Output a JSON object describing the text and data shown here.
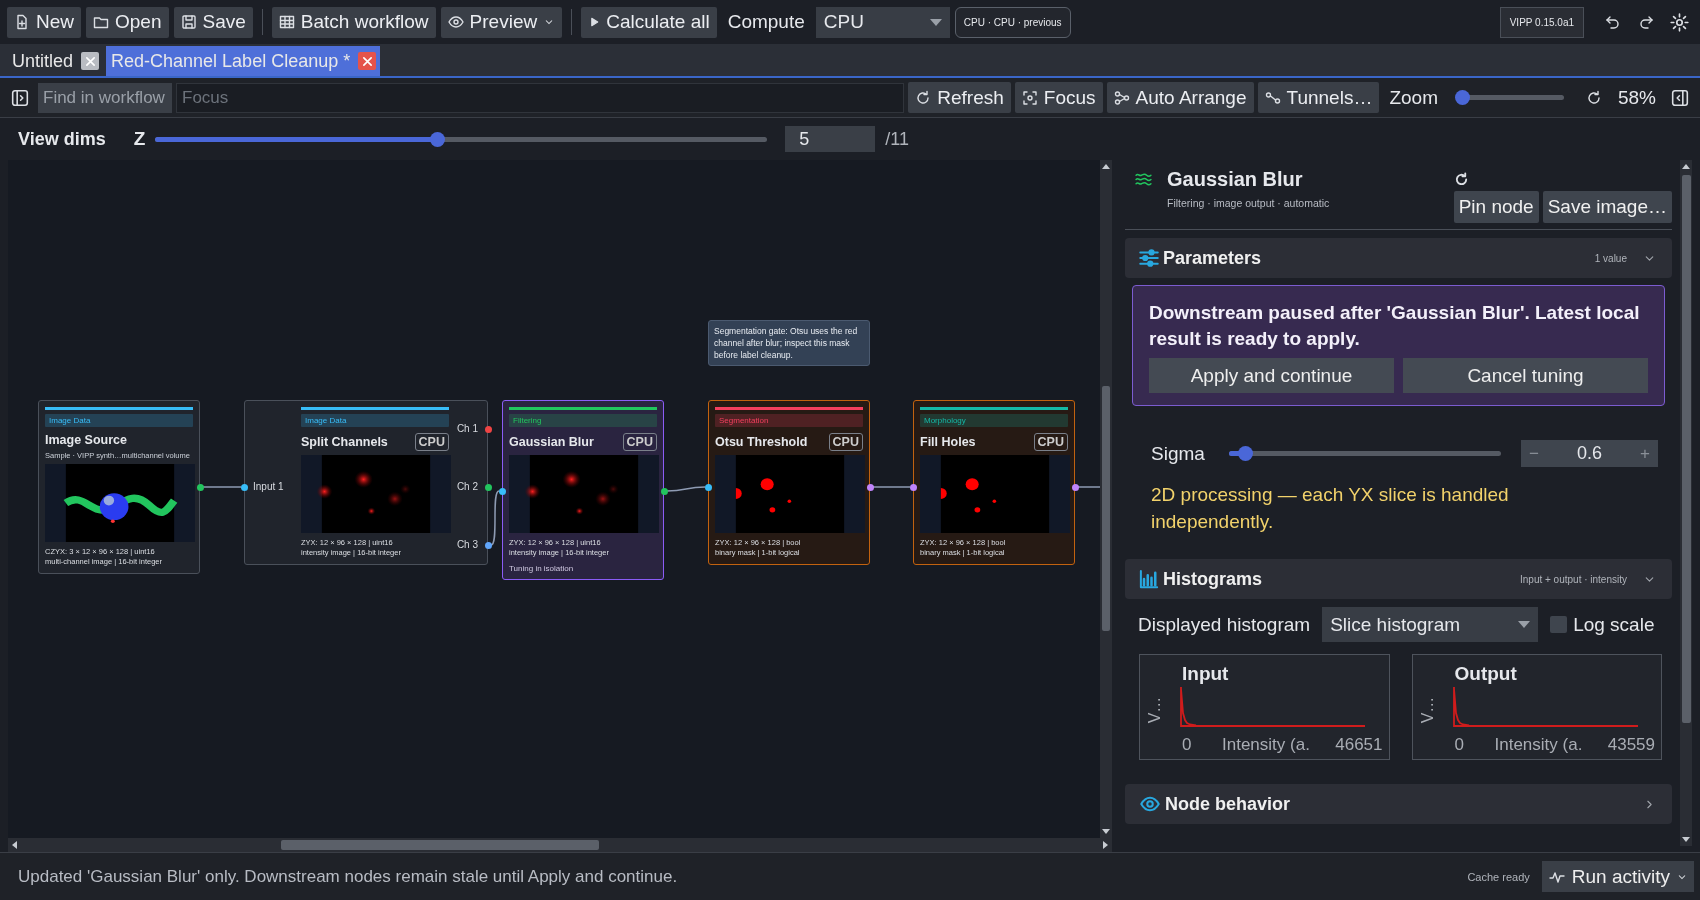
{
  "toolbar": {
    "buttons": [
      {
        "label": "New",
        "dropdown": false
      },
      {
        "label": "Open",
        "dropdown": false
      },
      {
        "label": "Save",
        "dropdown": false
      },
      {
        "label": "Batch workflow",
        "dropdown": false
      },
      {
        "label": "Preview",
        "dropdown": true
      },
      {
        "label": "Calculate all",
        "dropdown": false
      }
    ],
    "compute_label": "Compute",
    "compute_select": "CPU",
    "device_status": "CPU · CPU · previous",
    "version": "VIPP 0.15.0a1"
  },
  "tabs": [
    {
      "label": "Untitled",
      "selected": false
    },
    {
      "label": "Red-Channel Label Cleanup *",
      "selected": true
    }
  ],
  "workflow_bar": {
    "search_placeholder": "Find in workflow",
    "focus_placeholder": "Focus",
    "buttons": [
      "Refresh",
      "Focus",
      "Auto Arrange",
      "Tunnels…"
    ],
    "zoom": {
      "label": "Zoom",
      "level": 0.02,
      "reading": "58%"
    }
  },
  "view_dims": {
    "label": "View dims",
    "axis": "Z",
    "level": 0.46,
    "value": "5",
    "total": "/11"
  },
  "canvas": {
    "tooltip": "Segmentation gate: Otsu uses the red channel after blur; inspect this mask before label cleanup.",
    "nodes": [
      {
        "category": "Image Data",
        "color": "#38bdf8",
        "title": "Image Source",
        "subtitle": "Sample · VIPP synth…multichannel volume",
        "info": [
          "CZYX: 3 × 12 × 96 × 128 | uint16",
          "multi-channel image | 16-bit integer"
        ],
        "selected": false,
        "stale": false,
        "outputs": [
          {
            "color": "#22c55e"
          }
        ]
      },
      {
        "category": "Image Data",
        "color": "#38bdf8",
        "title": "Split Channels",
        "badge": "CPU",
        "info": [
          "ZYX: 12 × 96 × 128 | uint16",
          "intensity image | 16-bit integer"
        ],
        "selected": false,
        "stale": false,
        "inputs": [
          {
            "label": "Input 1",
            "color": "#38bdf8"
          }
        ],
        "outputs": [
          {
            "label": "Ch 1",
            "color": "#ef4444"
          },
          {
            "label": "Ch 2",
            "color": "#22c55e"
          },
          {
            "label": "Ch 3",
            "color": "#60a5fa"
          }
        ]
      },
      {
        "category": "Filtering",
        "color": "#22c55e",
        "title": "Gaussian Blur",
        "badge": "CPU",
        "info": [
          "ZYX: 12 × 96 × 128 | uint16",
          "intensity image | 16-bit integer"
        ],
        "status": "Tuning in isolation",
        "selected": true,
        "stale": false,
        "inputs": [
          {
            "color": "#38bdf8"
          }
        ],
        "outputs": [
          {
            "color": "#22c55e"
          }
        ]
      },
      {
        "category": "Segmentation",
        "color": "#f43f5e",
        "title": "Otsu Threshold",
        "badge": "CPU",
        "info": [
          "ZYX: 12 × 96 × 128 | bool",
          "binary mask | 1-bit logical"
        ],
        "selected": false,
        "stale": true,
        "inputs": [
          {
            "color": "#38bdf8"
          }
        ],
        "outputs": [
          {
            "color": "#c084fc"
          }
        ]
      },
      {
        "category": "Morphology",
        "color": "#14b8a6",
        "title": "Fill Holes",
        "badge": "CPU",
        "info": [
          "ZYX: 12 × 96 × 128 | bool",
          "binary mask | 1-bit logical"
        ],
        "selected": false,
        "stale": true,
        "inputs": [
          {
            "color": "#c084fc"
          }
        ],
        "outputs": [
          {
            "color": "#c084fc"
          }
        ]
      }
    ]
  },
  "inspector": {
    "title": "Gaussian Blur",
    "subtitle": "Filtering · image output · automatic",
    "buttons": [
      "Pin node",
      "Save image…"
    ],
    "sections": [
      {
        "kind": "parameters",
        "title": "Parameters",
        "summary": "1 value",
        "expanded": true,
        "notice": {
          "text": "Downstream paused after 'Gaussian Blur'. Latest local result is ready to apply.",
          "buttons": [
            "Apply and continue",
            "Cancel tuning"
          ]
        },
        "params": [
          {
            "name": "Sigma",
            "level": 0.06,
            "minus": "−",
            "value": "0.6",
            "plus": "+"
          }
        ],
        "note": "2D processing — each YX slice is handled independently."
      },
      {
        "kind": "histograms",
        "title": "Histograms",
        "summary": "Input + output · intensity",
        "expanded": true,
        "selector": {
          "label": "Displayed histogram",
          "value": "Slice histogram"
        },
        "log_scale": {
          "label": "Log scale",
          "checked": false
        },
        "plots": [
          {
            "title": "Input",
            "ylabel": "V…",
            "xmin": "0",
            "xlabel": "Intensity (a.",
            "xmax": "46651"
          },
          {
            "title": "Output",
            "ylabel": "V…",
            "xmin": "0",
            "xlabel": "Intensity (a.",
            "xmax": "43559"
          }
        ]
      },
      {
        "kind": "behavior",
        "title": "Node behavior",
        "expanded": false
      }
    ]
  },
  "status_bar": {
    "message": "Updated 'Gaussian Blur' only. Downstream nodes remain stale until Apply and continue.",
    "cache": "Cache ready",
    "run_button": "Run activity"
  }
}
